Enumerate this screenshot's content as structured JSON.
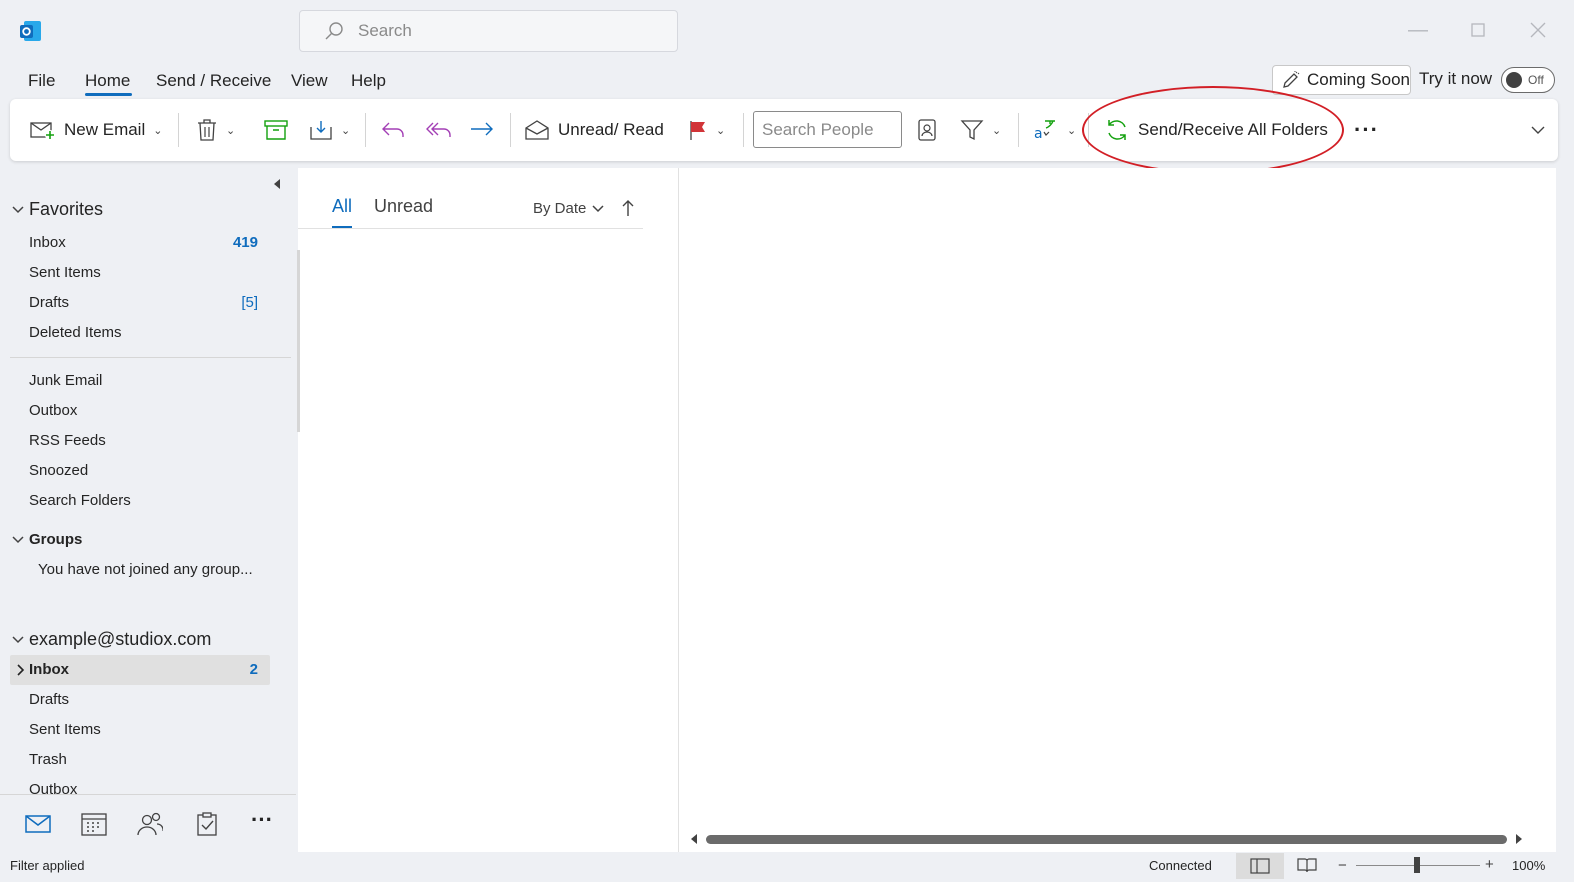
{
  "window": {
    "search_placeholder": "Search"
  },
  "menu": {
    "items": [
      "File",
      "Home",
      "Send / Receive",
      "View",
      "Help"
    ],
    "active": "Home",
    "coming_soon_label": "Coming Soon",
    "try_it_now_label": "Try it now",
    "toggle_state": "Off"
  },
  "ribbon": {
    "new_email_label": "New Email",
    "unread_read_label": "Unread/ Read",
    "search_people_placeholder": "Search People",
    "send_receive_label": "Send/Receive All Folders",
    "highlight_color": "#d21f26",
    "more_label": "···"
  },
  "folder_pane": {
    "favorites_label": "Favorites",
    "favorites": [
      {
        "name": "Inbox",
        "count": "419"
      },
      {
        "name": "Sent Items",
        "count": ""
      },
      {
        "name": "Drafts",
        "count": "[5]"
      },
      {
        "name": "Deleted Items",
        "count": ""
      }
    ],
    "other_folders": [
      "Junk Email",
      "Outbox",
      "RSS Feeds",
      "Snoozed",
      "Search Folders"
    ],
    "groups_label": "Groups",
    "groups_empty": "You have not joined any group...",
    "account": "example@studiox.com",
    "account_folders": [
      {
        "name": "Inbox",
        "count": "2"
      },
      {
        "name": "Drafts",
        "count": ""
      },
      {
        "name": "Sent Items",
        "count": ""
      },
      {
        "name": "Trash",
        "count": ""
      },
      {
        "name": "Outbox",
        "count": ""
      }
    ]
  },
  "message_list": {
    "tab_all": "All",
    "tab_unread": "Unread",
    "sort_label": "By Date"
  },
  "status": {
    "filter": "Filter applied",
    "connection": "Connected",
    "zoom": "100%"
  },
  "colors": {
    "accent": "#0f6cbd",
    "background": "#eef0f4"
  }
}
